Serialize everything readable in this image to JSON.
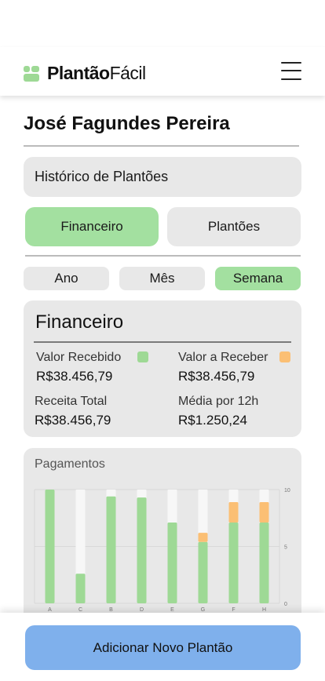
{
  "header": {
    "brand_bold": "Plantão",
    "brand_light": "Fácil"
  },
  "user": {
    "name": "José Fagundes Pereira"
  },
  "history_select": {
    "label": "Histórico de Plantões"
  },
  "tabs": [
    {
      "label": "Financeiro",
      "active": true
    },
    {
      "label": "Plantões",
      "active": false
    }
  ],
  "periods": [
    {
      "label": "Ano",
      "active": false
    },
    {
      "label": "Mês",
      "active": false
    },
    {
      "label": "Semana",
      "active": true
    }
  ],
  "financeiro": {
    "title": "Financeiro",
    "valor_recebido_label": "Valor Recebido",
    "valor_recebido": "R$38.456,79",
    "valor_receber_label": "Valor a Receber",
    "valor_receber": "R$38.456,79",
    "receita_total_label": "Receita Total",
    "receita_total": "R$38.456,79",
    "media_label": "Média por 12h",
    "media": "R$1.250,24"
  },
  "colors": {
    "received": "#9ed995",
    "pending": "#fbbf74",
    "empty": "#f7f7f7",
    "button": "#7fb0ec"
  },
  "payments": {
    "title": "Pagamentos",
    "chart_data": {
      "type": "bar",
      "stacked": true,
      "categories": [
        "A",
        "C",
        "B",
        "D",
        "E",
        "G",
        "F",
        "H"
      ],
      "ylim": [
        0,
        10
      ],
      "yticks": [
        "0",
        "5",
        "10"
      ],
      "series": [
        {
          "values": [
            10,
            2.6,
            9.4,
            9.3,
            7.1,
            5.4,
            7.1,
            7.1
          ]
        },
        {
          "values": [
            0,
            0,
            0,
            0,
            0,
            0.8,
            1.8,
            1.8
          ]
        }
      ]
    }
  },
  "add_button": {
    "label": "Adicionar Novo Plantão"
  }
}
